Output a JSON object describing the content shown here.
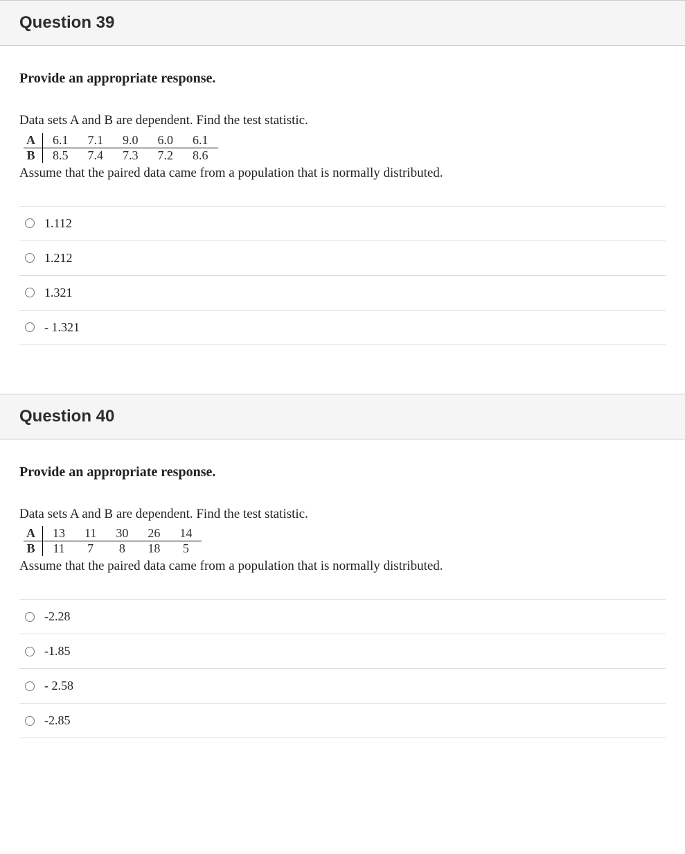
{
  "questions": [
    {
      "title": "Question 39",
      "instruction": "Provide an appropriate response.",
      "prompt": "Data sets A and B are dependent. Find the test statistic.",
      "table": {
        "rowA": {
          "label": "A",
          "v0": "6.1",
          "v1": "7.1",
          "v2": "9.0",
          "v3": "6.0",
          "v4": "6.1"
        },
        "rowB": {
          "label": "B",
          "v0": "8.5",
          "v1": "7.4",
          "v2": "7.3",
          "v3": "7.2",
          "v4": "8.6"
        }
      },
      "assumption": "Assume that the paired data came from a population that is normally distributed.",
      "options": {
        "o0": "1.112",
        "o1": "1.212",
        "o2": "1.321",
        "o3": "- 1.321"
      }
    },
    {
      "title": "Question 40",
      "instruction": "Provide an appropriate response.",
      "prompt": "Data sets A and B are dependent. Find the test statistic.",
      "table": {
        "rowA": {
          "label": "A",
          "v0": "13",
          "v1": "11",
          "v2": "30",
          "v3": "26",
          "v4": "14"
        },
        "rowB": {
          "label": "B",
          "v0": "11",
          "v1": "7",
          "v2": "8",
          "v3": "18",
          "v4": "5"
        }
      },
      "assumption": "Assume that the paired data came from a population that is normally distributed.",
      "options": {
        "o0": "-2.28",
        "o1": "-1.85",
        "o2": "- 2.58",
        "o3": "-2.85"
      }
    }
  ]
}
